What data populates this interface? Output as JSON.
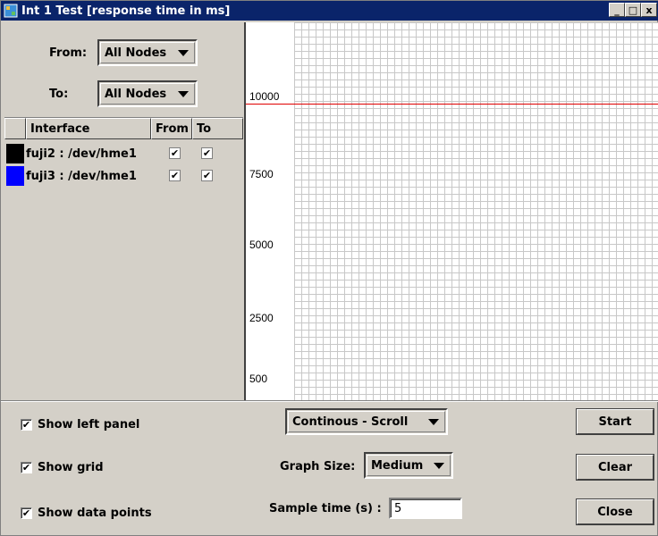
{
  "window": {
    "title": "Int 1 Test [response time in ms]",
    "controls": {
      "minimize": "_",
      "maximize": "□",
      "close": "x"
    }
  },
  "left_panel": {
    "from_label": "From:",
    "from_value": "All Nodes",
    "to_label": "To:",
    "to_value": "All Nodes",
    "table": {
      "columns": [
        "",
        "Interface",
        "From",
        "To"
      ],
      "rows": [
        {
          "color": "#000000",
          "interface": "fuji2 : /dev/hme1",
          "from": true,
          "to": true
        },
        {
          "color": "#0000ff",
          "interface": "fuji3 : /dev/hme1",
          "from": true,
          "to": true
        }
      ]
    },
    "check_mark": "✔"
  },
  "graph": {
    "y_ticks": [
      "10000",
      "7500",
      "5000",
      "2500",
      "500"
    ],
    "threshold_color": "#e00000"
  },
  "bottom": {
    "show_left_panel": "Show left panel",
    "show_grid": "Show grid",
    "show_data_points": "Show data points",
    "mode_value": "Continous - Scroll",
    "graph_size_label": "Graph Size:",
    "graph_size_value": "Medium",
    "sample_time_label": "Sample time (s) :",
    "sample_time_value": "5",
    "start_label": "Start",
    "clear_label": "Clear",
    "close_label": "Close",
    "check_mark": "✔"
  }
}
